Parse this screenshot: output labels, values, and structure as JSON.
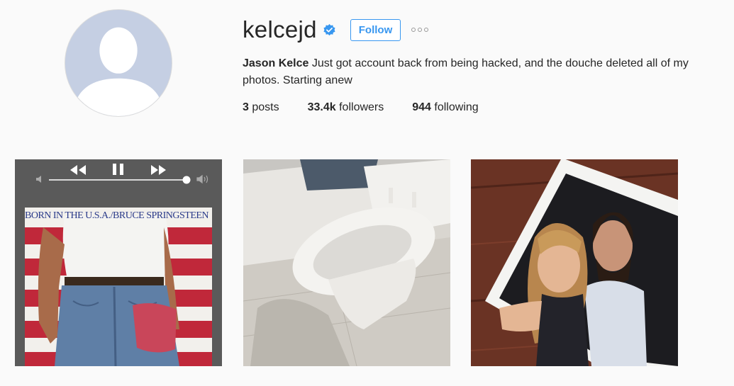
{
  "profile": {
    "username": "kelcejd",
    "follow_label": "Follow",
    "full_name": "Jason Kelce",
    "bio_text": "Just got account back from being hacked, and the douche deleted all of my photos. Starting anew"
  },
  "stats": {
    "posts_count": "3",
    "posts_label": "posts",
    "followers_count": "33.4k",
    "followers_label": "followers",
    "following_count": "944",
    "following_label": "following"
  },
  "posts": {
    "album_title": "BORN IN THE U.S.A./BRUCE SPRINGSTEEN"
  },
  "icons": {
    "verified": "verified-badge-icon",
    "more": "more-options-icon",
    "rewind": "rewind-icon",
    "pause": "pause-icon",
    "fast_forward": "fast-forward-icon",
    "volume_low": "volume-low-icon",
    "volume_high": "volume-high-icon"
  },
  "colors": {
    "follow_blue": "#3897f0",
    "verified_blue": "#3897f0",
    "background": "#fafafa"
  }
}
